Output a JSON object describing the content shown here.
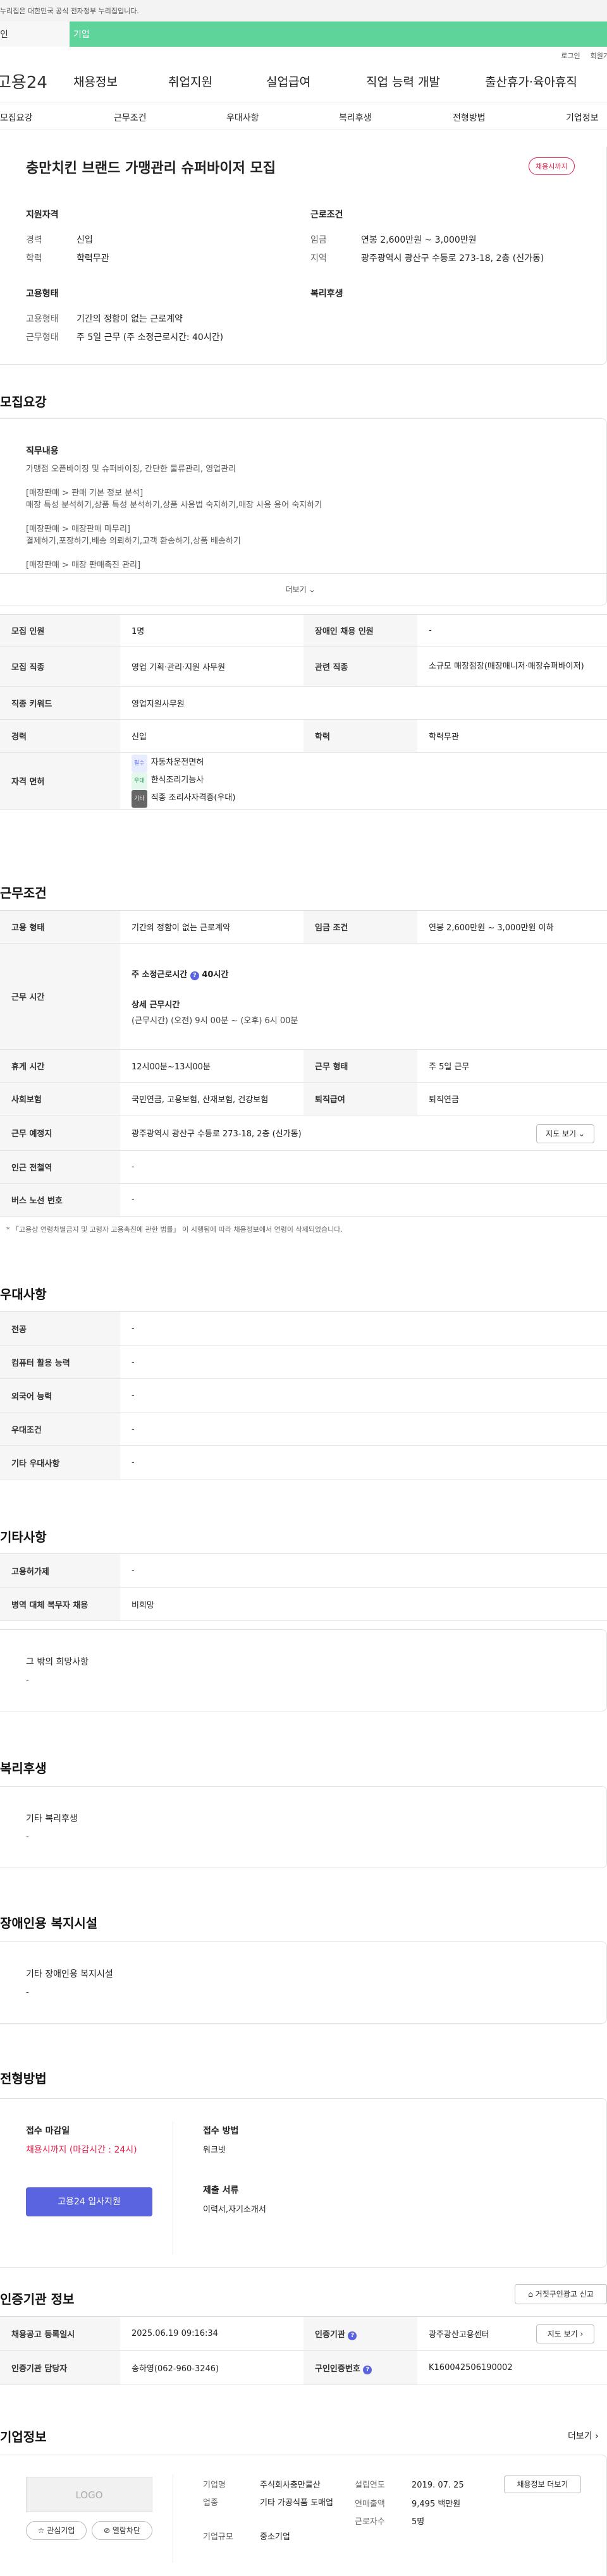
{
  "gov_banner": "누리집은 대한민국 공식 전자정부 누리집입니다.",
  "top_tabs": {
    "personal": "인",
    "company": "기업"
  },
  "util": {
    "login": "로그인",
    "join": "회원가"
  },
  "gnb": {
    "logo": "고용24",
    "menu": [
      "채용정보",
      "취업지원",
      "실업급여",
      "직업 능력 개발",
      "출산휴가·육아휴직"
    ]
  },
  "snb": [
    "모집요강",
    "근무조건",
    "우대사항",
    "복리후생",
    "전형방법",
    "기업정보"
  ],
  "summary": {
    "title": "충만치킨 브랜드 가맹관리 슈퍼바이저 모집",
    "badge": "채용시까지",
    "qual_title": "지원자격",
    "career_k": "경력",
    "career_v": "신입",
    "edu_k": "학력",
    "edu_v": "학력무관",
    "cond_title": "근로조건",
    "wage_k": "임금",
    "wage_v": "연봉 2,600만원 ~ 3,000만원",
    "loc_k": "지역",
    "loc_v": "광주광역시 광산구 수등로 273-18, 2층 (신가동)",
    "emp_title": "고용형태",
    "etype_k": "고용형태",
    "etype_v": "기간의 정함이 없는 근로계약",
    "hours_k": "근무형태",
    "hours_v": "주 5일 근무 (주 소정근로시간: 40시간)",
    "welfare_title": "복리후생"
  },
  "recruit": {
    "title": "모집요강",
    "duty_title": "직무내용",
    "duty_lines": [
      "가맹점 오픈바이징 및 슈퍼바이징, 간단한 물류관리, 영업관리",
      "[매장판매 > 판매 기본 정보 분석]",
      "매장 특성 분석하기,상품 특성 분석하기,상품 사용법 숙지하기,매장 사용 용어 숙지하기",
      "[매장판매 > 매장판매 마무리]",
      "결제하기,포장하기,배송 의뢰하기,고객 환송하기,상품 배송하기",
      "[매장판매 > 매장 판매촉진 관리]"
    ],
    "more": "더보기",
    "rows": [
      {
        "k": "모집 인원",
        "v": "1명",
        "k2": "장애인 채용 인원",
        "v2": "-"
      },
      {
        "k": "모집 직종",
        "v": "영업 기획·관리·지원 사무원",
        "k2": "관련 직종",
        "v2": "소규모 매장점장(매장매니저·매장슈퍼바이저)"
      },
      {
        "k": "직종 키워드",
        "v": "영업지원사무원"
      },
      {
        "k": "경력",
        "v": "신입",
        "k2": "학력",
        "v2": "학력무관"
      }
    ],
    "license_k": "자격 면허",
    "licenses": [
      {
        "tag": "필수",
        "name": "자동차운전면허"
      },
      {
        "tag": "우대",
        "name": "한식조리기능사"
      },
      {
        "tag": "기타",
        "name": "직종 조리사자격증(우대)"
      }
    ]
  },
  "work": {
    "title": "근무조건",
    "etype_k": "고용 형태",
    "etype_v": "기간의 정함이 없는 근로계약",
    "wage_k": "임금 조건",
    "wage_v": "연봉 2,600만원 ~ 3,000만원 이하",
    "time_k": "근무 시간",
    "time_main": "주 소정근로시간",
    "time_hours": "40시간",
    "time_detail_t": "상세 근무시간",
    "time_detail": "(근무시간) (오전) 9시 00분 ~ (오후) 6시 00분",
    "rest_k": "휴게 시간",
    "rest_v": "12시00분~13시00분",
    "shape_k": "근무 형태",
    "shape_v": "주 5일 근무",
    "ins_k": "사회보험",
    "ins_v": "국민연금, 고용보험, 산재보험, 건강보험",
    "sev_k": "퇴직급여",
    "sev_v": "퇴직연금",
    "place_k": "근무 예정지",
    "place_v": "광주광역시 광산구 수등로 273-18, 2층 (신가동)",
    "map_btn": "지도 보기",
    "subway_k": "인근 전철역",
    "subway_v": "-",
    "bus_k": "버스 노선 번호",
    "bus_v": "-",
    "note": "* 「고용상 연령차별금지 및 고령자 고용촉진에 관한 법률」 이 시행됨에 따라 채용정보에서 연령이 삭제되었습니다."
  },
  "pref": {
    "title": "우대사항",
    "rows": [
      {
        "k": "전공",
        "v": "-"
      },
      {
        "k": "컴퓨터 활용 능력",
        "v": "-"
      },
      {
        "k": "외국어 능력",
        "v": "-"
      },
      {
        "k": "우대조건",
        "v": "-"
      },
      {
        "k": "기타 우대사항",
        "v": "-"
      }
    ]
  },
  "etc": {
    "title": "기타사항",
    "rows": [
      {
        "k": "고용허가제",
        "v": "-"
      },
      {
        "k": "병역 대체 복무자 채용",
        "v": "비희망"
      }
    ],
    "hope_t": "그 밖의 희망사항",
    "hope_v": "-"
  },
  "welfare": {
    "title": "복리후생",
    "t": "기타 복리후생",
    "v": "-"
  },
  "facility": {
    "title": "장애인용 복지시설",
    "t": "기타 장애인용 복지시설",
    "v": "-"
  },
  "process": {
    "title": "전형방법",
    "deadline_t": "접수 마감일",
    "deadline_v": "채용시까지 (마감시간 : 24시)",
    "apply_btn": "고용24 입사지원",
    "method_t": "접수 방법",
    "method_v": "워크넷",
    "docs_t": "제출 서류",
    "docs_v": "이력서,자기소개서"
  },
  "agency": {
    "title": "인증기관 정보",
    "report_btn": "거짓구인광고 신고",
    "reg_k": "채용공고 등록일시",
    "reg_v": "2025.06.19 09:16:34",
    "org_k": "인증기관",
    "org_v": "광주광산고용센터",
    "map_btn": "지도 보기",
    "mgr_k": "인증기관 담당자",
    "mgr_v": "송하영(062-960-3246)",
    "no_k": "구인인증번호",
    "no_v": "K160042506190002"
  },
  "company": {
    "title": "기업정보",
    "more": "더보기",
    "logo": "LOGO",
    "fav": "관심기업",
    "block": "열람차단",
    "name_k": "기업명",
    "name_v": "주식회사충만물산",
    "ind_k": "업종",
    "ind_v": "기타 가공식품 도매업",
    "size_k": "기업규모",
    "size_v": "중소기업",
    "est_k": "설립연도",
    "est_v": "2019. 07. 25",
    "rev_k": "연매출액",
    "rev_v": "9,495 백만원",
    "emp_k": "근로자수",
    "emp_v": "5명",
    "jobs_btn": "채용정보 더보기"
  },
  "colors": {
    "accent": "#5a64e0",
    "green": "#5ed49a",
    "red": "#e6204d"
  }
}
